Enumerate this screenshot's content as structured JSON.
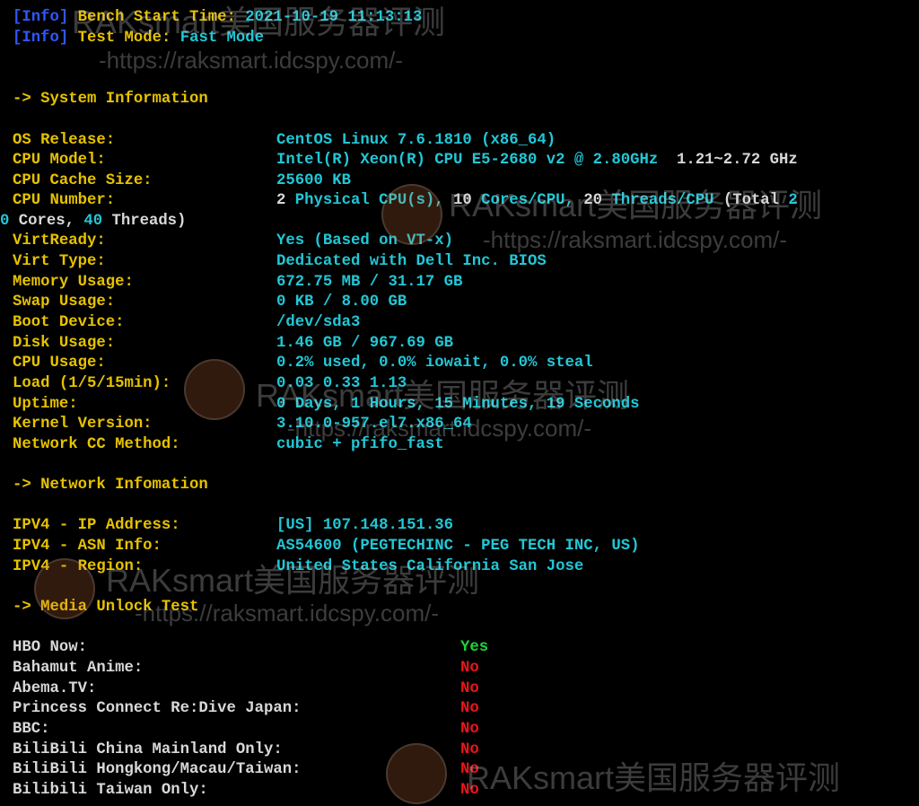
{
  "header": {
    "info_tag": "[Info]",
    "bench_start_label": "Bench Start Time:",
    "bench_start_value": "2021-10-19 11:13:13",
    "test_mode_label": "Test Mode:",
    "test_mode_value": "Fast Mode"
  },
  "sections": {
    "system": "-> System Information",
    "network": "-> Network Infomation",
    "media": "-> Media Unlock Test"
  },
  "system": {
    "os_label": "OS Release:",
    "os_value": "CentOS Linux 7.6.1810 (x86_64)",
    "cpu_model_label": "CPU Model:",
    "cpu_model_value": "Intel(R) Xeon(R) CPU E5-2680 v2 @ 2.80GHz",
    "cpu_model_freq": "1.21~2.72 GHz",
    "cache_label": "CPU Cache Size:",
    "cache_value": "25600 KB",
    "cpu_number_label": "CPU Number:",
    "cpu_n1": "2",
    "cpu_t1": " Physical CPU(s), ",
    "cpu_n2": "10",
    "cpu_t2": " Cores/CPU, ",
    "cpu_n3": "20",
    "cpu_t3": " Threads/CPU ",
    "cpu_t4": "(Total ",
    "cpu_n4a": "2",
    "cpu_n4b": "0",
    "cpu_t5": " Cores, ",
    "cpu_n5": "40",
    "cpu_t6": " Threads)",
    "virtready_label": "VirtReady:",
    "virtready_value": "Yes (Based on VT-x)",
    "virttype_label": "Virt Type:",
    "virttype_value": "Dedicated with Dell Inc. BIOS",
    "memory_label": "Memory Usage:",
    "memory_value": "672.75 MB / 31.17 GB",
    "swap_label": "Swap Usage:",
    "swap_value": "0 KB / 8.00 GB",
    "boot_label": "Boot Device:",
    "boot_value": "/dev/sda3",
    "disk_label": "Disk Usage:",
    "disk_value": "1.46 GB / 967.69 GB",
    "cpuusage_label": "CPU Usage:",
    "cpuusage_value": "0.2% used, 0.0% iowait, 0.0% steal",
    "load_label": "Load (1/5/15min):",
    "load_value": "0.03 0.33 1.13",
    "uptime_label": "Uptime:",
    "uptime_value": "0 Days, 1 Hours, 15 Minutes, 19 Seconds",
    "kernel_label": "Kernel Version:",
    "kernel_value": "3.10.0-957.el7.x86_64",
    "cc_label": "Network CC Method:",
    "cc_value": "cubic + pfifo_fast"
  },
  "network": {
    "ip_label": "IPV4 - IP Address:",
    "ip_value": "[US] 107.148.151.36",
    "asn_label": "IPV4 - ASN Info:",
    "asn_value": "AS54600 (PEGTECHINC - PEG TECH INC, US)",
    "region_label": "IPV4 - Region:",
    "region_value": "United States California San Jose"
  },
  "media": [
    {
      "label": "HBO Now:",
      "result": "Yes",
      "status": "yes"
    },
    {
      "label": "Bahamut Anime:",
      "result": "No",
      "status": "no"
    },
    {
      "label": "Abema.TV:",
      "result": "No",
      "status": "no"
    },
    {
      "label": "Princess Connect Re:Dive Japan:",
      "result": "No",
      "status": "no"
    },
    {
      "label": "BBC:",
      "result": "No",
      "status": "no"
    },
    {
      "label": "BiliBili China Mainland Only:",
      "result": "No",
      "status": "no"
    },
    {
      "label": "BiliBili Hongkong/Macau/Taiwan:",
      "result": "No",
      "status": "no"
    },
    {
      "label": "Bilibili Taiwan Only:",
      "result": "No",
      "status": "no"
    }
  ],
  "watermark": {
    "brand": "RAKsmart美国服务器评测",
    "url": "-https://raksmart.idcspy.com/-"
  },
  "colors": {
    "background": "#000000",
    "label": "#e6c200",
    "value": "#22c7d6",
    "plain": "#d8d8d8",
    "info_tag": "#2f57ff",
    "yes": "#19d43a",
    "no": "#e8161a"
  }
}
